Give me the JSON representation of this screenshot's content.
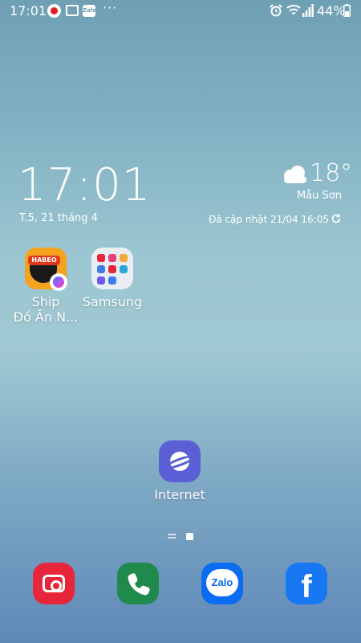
{
  "status_bar": {
    "time": "17:01",
    "zalo_label": "Zalo",
    "battery": "44%",
    "icons": [
      "notification-dot-icon",
      "gallery-icon",
      "zalo-icon",
      "more-icon",
      "alarm-icon",
      "wifi-icon",
      "signal-icon",
      "battery-icon"
    ]
  },
  "clock_widget": {
    "time": "17:01",
    "date": "T.5, 21 tháng 4"
  },
  "weather_widget": {
    "temperature": "18°",
    "location": "Mẫu Sơn",
    "updated": "Đã cập nhật 21/04 16:05",
    "icons": [
      "cloud-icon",
      "refresh-icon"
    ]
  },
  "apps": [
    {
      "label_line1": "Ship",
      "label_line2": "Đồ Ăn N...",
      "icon": "ship-do-an-icon",
      "logo_text": "HABEO"
    },
    {
      "label": "Samsung",
      "icon": "samsung-folder-icon"
    },
    {
      "label": "Internet",
      "icon": "internet-icon"
    }
  ],
  "dock": [
    {
      "icon": "camera-icon"
    },
    {
      "icon": "phone-icon"
    },
    {
      "icon": "zalo-icon",
      "label": "Zalo"
    },
    {
      "icon": "facebook-icon",
      "glyph": "f"
    }
  ],
  "colors": {
    "camera": "#e8263b",
    "phone": "#1f8a4c",
    "zalo": "#0a6cf0",
    "facebook": "#1877f2",
    "internet": "#5b5fd6"
  }
}
